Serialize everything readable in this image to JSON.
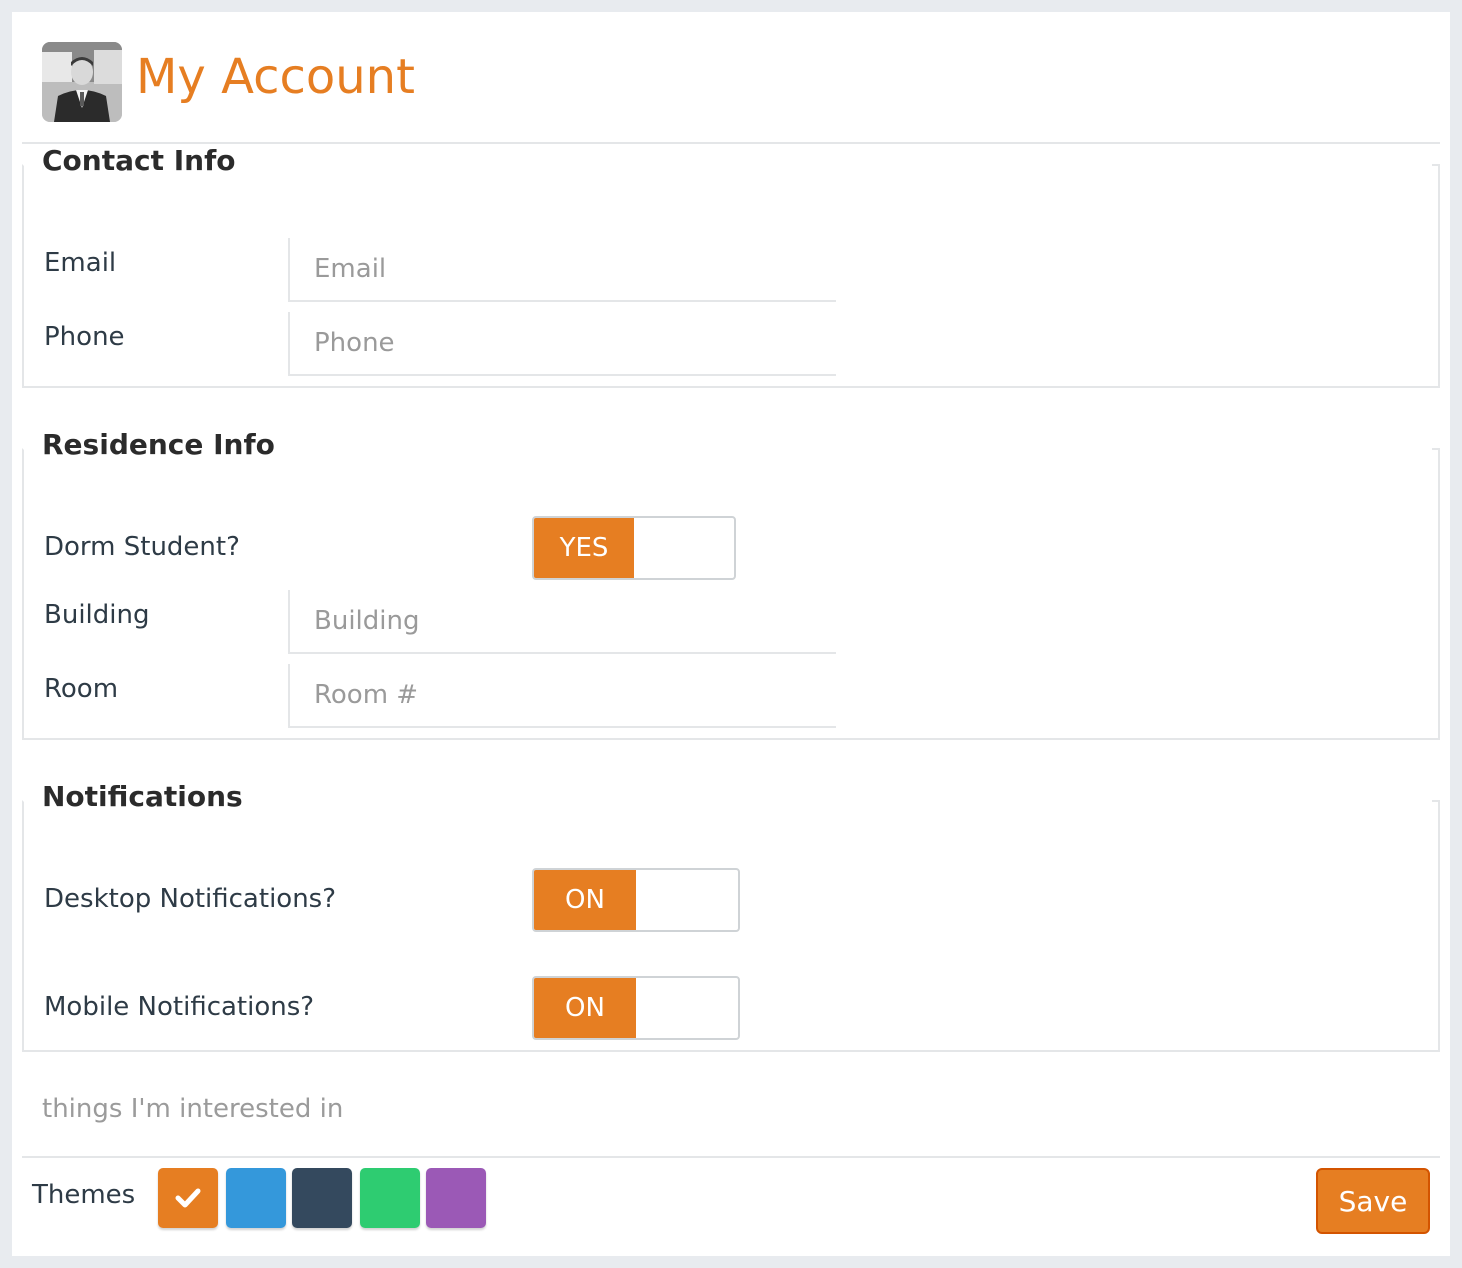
{
  "header": {
    "title": "My Account"
  },
  "contact": {
    "legend": "Contact Info",
    "email_label": "Email",
    "email_placeholder": "Email",
    "email_value": "",
    "phone_label": "Phone",
    "phone_placeholder": "Phone",
    "phone_value": ""
  },
  "residence": {
    "legend": "Residence Info",
    "dorm_label": "Dorm Student?",
    "dorm_toggle": "YES",
    "building_label": "Building",
    "building_placeholder": "Building",
    "building_value": "",
    "room_label": "Room",
    "room_placeholder": "Room #",
    "room_value": ""
  },
  "notifications": {
    "legend": "Notifications",
    "desktop_label": "Desktop Notifications?",
    "desktop_toggle": "ON",
    "mobile_label": "Mobile Notifications?",
    "mobile_toggle": "ON"
  },
  "interests": {
    "placeholder": "things I'm interested in"
  },
  "footer": {
    "themes_label": "Themes",
    "themes": [
      {
        "name": "orange",
        "color": "#e67e22",
        "selected": true
      },
      {
        "name": "blue",
        "color": "#3498db",
        "selected": false
      },
      {
        "name": "dark",
        "color": "#34495e",
        "selected": false
      },
      {
        "name": "green",
        "color": "#2ecc71",
        "selected": false
      },
      {
        "name": "purple",
        "color": "#9b59b6",
        "selected": false
      }
    ],
    "save_label": "Save"
  },
  "colors": {
    "accent": "#e67e22",
    "accent_border": "#d35400"
  }
}
